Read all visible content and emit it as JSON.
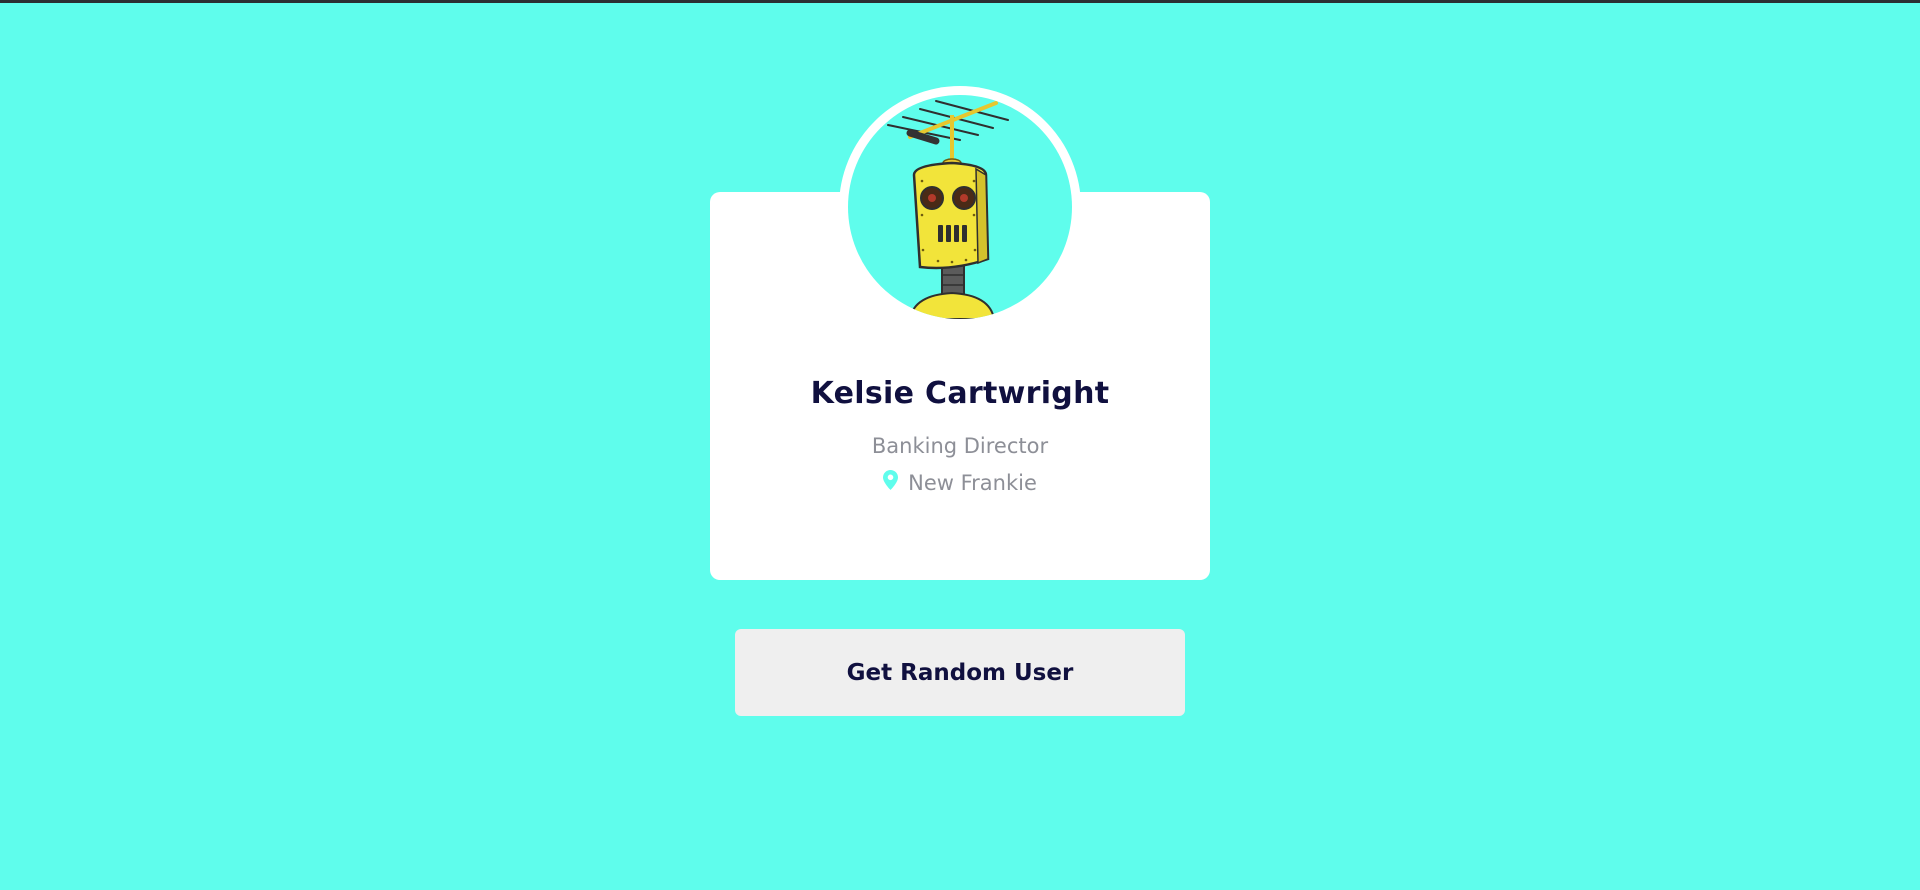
{
  "theme": {
    "background": "#5ffdec",
    "card_background": "#ffffff",
    "name_color": "#10103f",
    "muted_text_color": "#8d8f97",
    "button_background": "#efefef",
    "accent": "#5ffdec"
  },
  "profile": {
    "avatar_icon": "robot-avatar",
    "name": "Kelsie Cartwright",
    "job_title": "Banking Director",
    "location_icon": "map-pin-icon",
    "location": "New Frankie"
  },
  "actions": {
    "random_user_label": "Get Random User"
  }
}
